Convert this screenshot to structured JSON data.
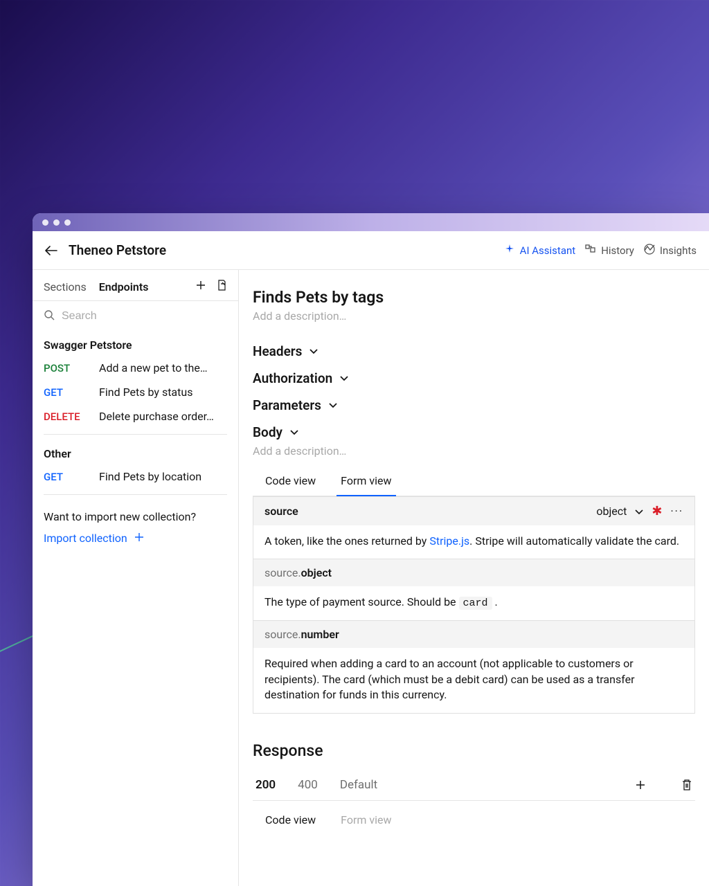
{
  "header": {
    "title": "Theneo Petstore",
    "links": {
      "ai": "AI Assistant",
      "history": "History",
      "insights": "Insights"
    }
  },
  "sidebar": {
    "tabs": {
      "sections": "Sections",
      "endpoints": "Endpoints"
    },
    "search_placeholder": "Search",
    "groups": [
      {
        "title": "Swagger Petstore",
        "items": [
          {
            "method": "POST",
            "label": "Add a new pet to the…"
          },
          {
            "method": "GET",
            "label": "Find Pets by status"
          },
          {
            "method": "DELETE",
            "label": "Delete purchase order…"
          }
        ]
      },
      {
        "title": "Other",
        "items": [
          {
            "method": "GET",
            "label": "Find Pets by location"
          }
        ]
      }
    ],
    "import_prompt": "Want to import new collection?",
    "import_link": "Import collection"
  },
  "main": {
    "title": "Finds Pets by tags",
    "desc_placeholder": "Add a description…",
    "sections": {
      "headers": "Headers",
      "authorization": "Authorization",
      "parameters": "Parameters",
      "body": "Body"
    },
    "body_desc_placeholder": "Add a description…",
    "view_tabs": {
      "code": "Code view",
      "form": "Form view"
    },
    "params": [
      {
        "name_light": "",
        "name_bold": "source",
        "type": "object",
        "required": true,
        "desc_prefix": "A token, like the ones returned by ",
        "desc_link": "Stripe.js",
        "desc_suffix": ". Stripe will automatically validate the card."
      },
      {
        "name_light": "source.",
        "name_bold": "object",
        "type": "",
        "required": false,
        "desc_prefix": "The type of payment source. Should be ",
        "desc_code": "card",
        "desc_suffix": " ."
      },
      {
        "name_light": "source.",
        "name_bold": "number",
        "type": "",
        "required": false,
        "desc_plain": "Required when adding a card to an account (not applicable to customers or recipients). The card (which must be a debit card) can be used as a transfer destination for funds in this currency."
      }
    ],
    "response": {
      "heading": "Response",
      "statuses": [
        "200",
        "400",
        "Default"
      ],
      "view_tabs": {
        "code": "Code view",
        "form": "Form view"
      }
    }
  }
}
